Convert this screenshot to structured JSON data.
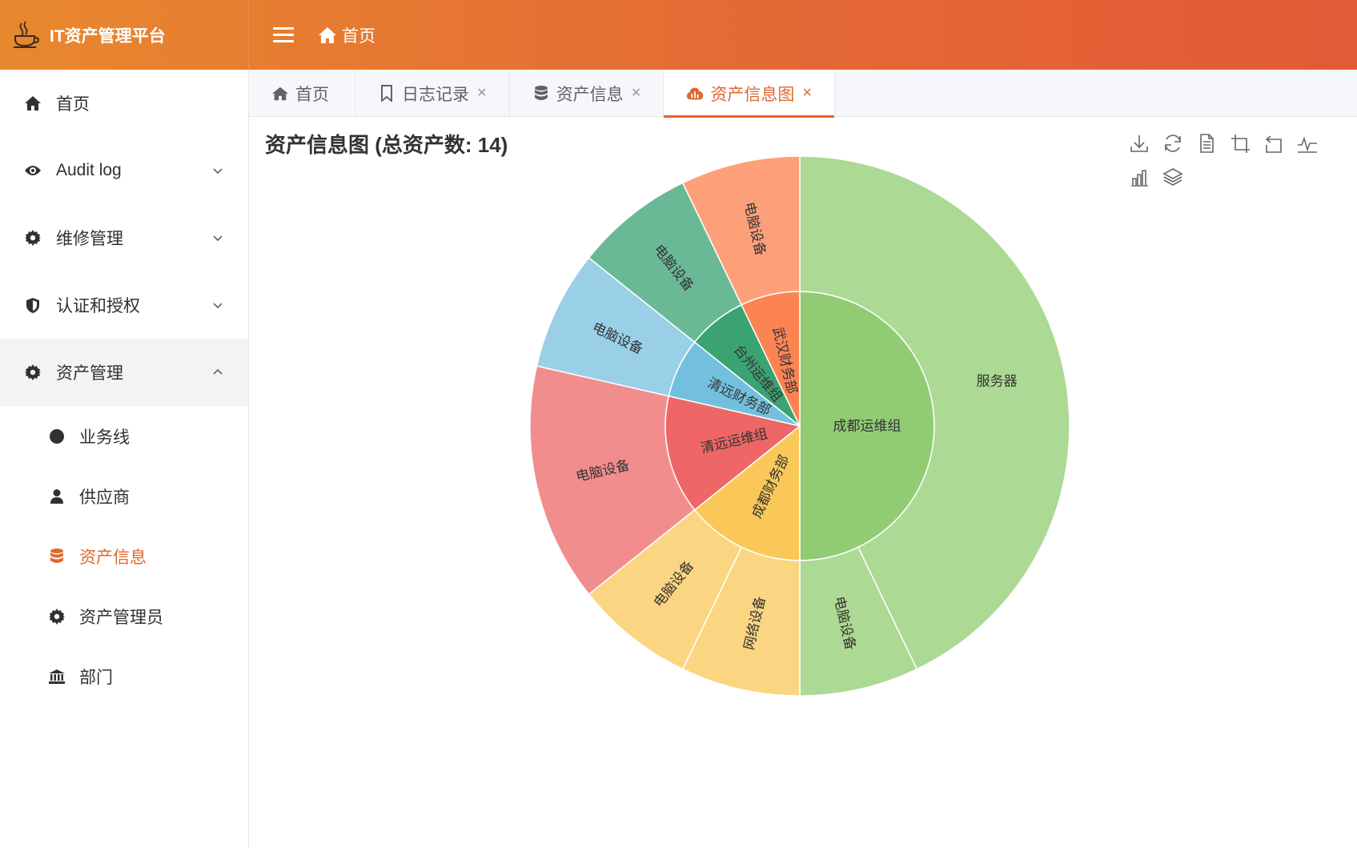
{
  "app": {
    "title": "IT资产管理平台"
  },
  "header": {
    "breadcrumb": "首页"
  },
  "sidebar": {
    "items": [
      {
        "label": "首页",
        "icon": "home-icon"
      },
      {
        "label": "Audit log",
        "icon": "eye-icon",
        "expandable": true
      },
      {
        "label": "维修管理",
        "icon": "gear-icon",
        "expandable": true
      },
      {
        "label": "认证和授权",
        "icon": "shield-icon",
        "expandable": true
      },
      {
        "label": "资产管理",
        "icon": "gear-icon",
        "expandable": true,
        "open": true
      }
    ],
    "sub_items": [
      {
        "label": "业务线",
        "icon": "circle-icon"
      },
      {
        "label": "供应商",
        "icon": "user-icon"
      },
      {
        "label": "资产信息",
        "icon": "database-icon",
        "active": true
      },
      {
        "label": "资产管理员",
        "icon": "gear-icon"
      },
      {
        "label": "部门",
        "icon": "bank-icon"
      }
    ]
  },
  "tabs": [
    {
      "label": "首页",
      "icon": "home-icon",
      "closable": false
    },
    {
      "label": "日志记录",
      "icon": "bookmark-icon",
      "closable": true
    },
    {
      "label": "资产信息",
      "icon": "database-icon",
      "closable": true
    },
    {
      "label": "资产信息图",
      "icon": "cloud-chart-icon",
      "closable": true,
      "active": true
    }
  ],
  "toolbox": [
    "download-icon",
    "refresh-icon",
    "data-view-icon",
    "zoom-icon",
    "zoom-reset-icon",
    "line-chart-icon",
    "bar-chart-icon",
    "stack-icon"
  ],
  "colors": {
    "accent": "#e0672f"
  },
  "chart_data": {
    "type": "sunburst",
    "title": "资产信息图 (总资产数: 14)",
    "total": 14,
    "inner": [
      {
        "name": "成都运维组",
        "value": 7,
        "color": "#91cc75"
      },
      {
        "name": "成都财务部",
        "value": 2,
        "color": "#fac858"
      },
      {
        "name": "清远运维组",
        "value": 2,
        "color": "#ee6666"
      },
      {
        "name": "清远财务部",
        "value": 1,
        "color": "#73c0de"
      },
      {
        "name": "台州运维组",
        "value": 1,
        "color": "#3ba272"
      },
      {
        "name": "武汉财务部",
        "value": 1,
        "color": "#fc8452"
      }
    ],
    "outer": [
      {
        "name": "服务器",
        "parent": "成都运维组",
        "value": 6,
        "color": "#acd993"
      },
      {
        "name": "电脑设备",
        "parent": "成都运维组",
        "value": 1,
        "color": "#acd993"
      },
      {
        "name": "网络设备",
        "parent": "成都财务部",
        "value": 1,
        "color": "#fbd582"
      },
      {
        "name": "电脑设备",
        "parent": "成都财务部",
        "value": 1,
        "color": "#fbd582"
      },
      {
        "name": "电脑设备",
        "parent": "清远运维组",
        "value": 2,
        "color": "#f28d8d"
      },
      {
        "name": "电脑设备",
        "parent": "清远财务部",
        "value": 1,
        "color": "#99cfe7"
      },
      {
        "name": "电脑设备",
        "parent": "台州运维组",
        "value": 1,
        "color": "#6ab996"
      },
      {
        "name": "电脑设备",
        "parent": "武汉财务部",
        "value": 1,
        "color": "#fda07a"
      }
    ]
  }
}
